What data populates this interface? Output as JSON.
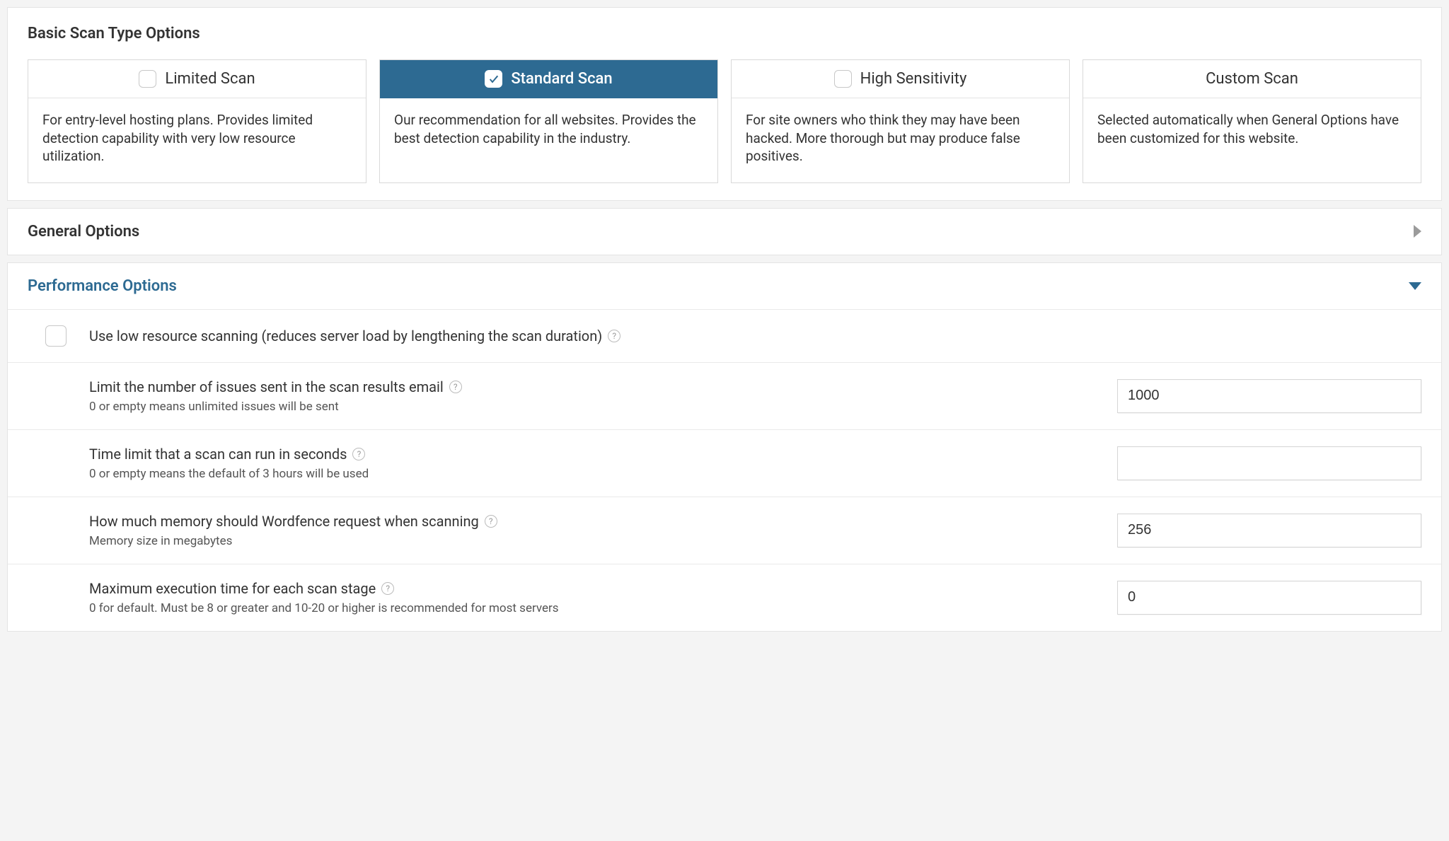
{
  "basic_scan": {
    "title": "Basic Scan Type Options",
    "cards": [
      {
        "label": "Limited Scan",
        "desc": "For entry-level hosting plans. Provides limited detection capability with very low resource utilization.",
        "selected": false,
        "has_checkbox": true
      },
      {
        "label": "Standard Scan",
        "desc": "Our recommendation for all websites. Provides the best detection capability in the industry.",
        "selected": true,
        "has_checkbox": true
      },
      {
        "label": "High Sensitivity",
        "desc": "For site owners who think they may have been hacked. More thorough but may produce false positives.",
        "selected": false,
        "has_checkbox": true
      },
      {
        "label": "Custom Scan",
        "desc": "Selected automatically when General Options have been customized for this website.",
        "selected": false,
        "has_checkbox": false
      }
    ]
  },
  "general_options": {
    "title": "General Options",
    "expanded": false
  },
  "performance_options": {
    "title": "Performance Options",
    "expanded": true,
    "low_resource": {
      "label": "Use low resource scanning (reduces server load by lengthening the scan duration)",
      "checked": false
    },
    "rows": [
      {
        "label": "Limit the number of issues sent in the scan results email",
        "sub": "0 or empty means unlimited issues will be sent",
        "value": "1000"
      },
      {
        "label": "Time limit that a scan can run in seconds",
        "sub": "0 or empty means the default of 3 hours will be used",
        "value": ""
      },
      {
        "label": "How much memory should Wordfence request when scanning",
        "sub": "Memory size in megabytes",
        "value": "256"
      },
      {
        "label": "Maximum execution time for each scan stage",
        "sub": "0 for default. Must be 8 or greater and 10-20 or higher is recommended for most servers",
        "value": "0"
      }
    ]
  }
}
